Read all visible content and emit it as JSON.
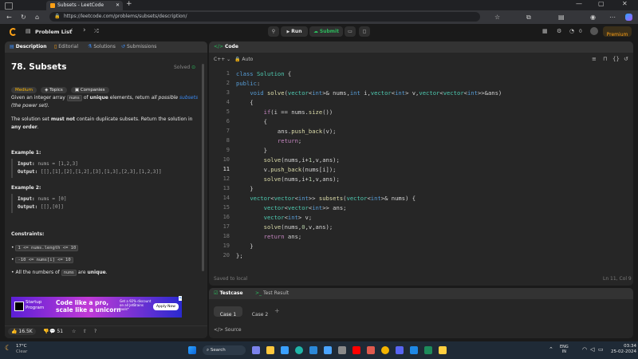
{
  "browser": {
    "tab_title": "Subsets - LeetCode",
    "new_tab": "+",
    "url": "https://leetcode.com/problems/subsets/description/"
  },
  "header": {
    "problem_list": "Problem List",
    "run": "Run",
    "submit": "Submit",
    "streak": "0",
    "premium": "Premium"
  },
  "left_tabs": [
    "Description",
    "Editorial",
    "Solutions",
    "Submissions"
  ],
  "problem": {
    "title": "78. Subsets",
    "status": "Solved",
    "difficulty": "Medium",
    "topics": "Topics",
    "companies": "Companies",
    "desc_1_a": "Given an integer array ",
    "desc_1_code": "nums",
    "desc_1_b": " of ",
    "desc_1_bold": "unique",
    "desc_1_c": " elements, return ",
    "desc_1_i": "all possible ",
    "desc_1_link": "subsets",
    "desc_1_d": " (the power set).",
    "desc_2_a": "The solution set ",
    "desc_2_bold": "must not",
    "desc_2_b": " contain duplicate subsets. Return the solution in ",
    "desc_2_bold2": "any order",
    "desc_2_c": ".",
    "ex1_title": "Example 1:",
    "ex1_input_label": "Input:",
    "ex1_input": "nums = [1,2,3]",
    "ex1_output_label": "Output:",
    "ex1_output": "[[],[1],[2],[1,2],[3],[1,3],[2,3],[1,2,3]]",
    "ex2_title": "Example 2:",
    "ex2_input_label": "Input:",
    "ex2_input": "nums = [0]",
    "ex2_output_label": "Output:",
    "ex2_output": "[[],[0]]",
    "constraints_title": "Constraints:",
    "c1": "1 <= nums.length <= 10",
    "c2": "-10 <= nums[i] <= 10",
    "c3_a": "All the numbers of ",
    "c3_code": "nums",
    "c3_b": " are ",
    "c3_bold": "unique",
    "c3_c": ".",
    "likes": "16.5K",
    "comments": "51"
  },
  "ad": {
    "brand_line1": "Startup",
    "brand_line2": "Program",
    "headline1": "Code like a pro,",
    "headline2": "scale like a unicorn",
    "offer": "Get a 92% discount on all JetBrains tools*",
    "cta": "Apply Now"
  },
  "code": {
    "tab": "Code",
    "lang": "C++",
    "mode": "Auto",
    "saved": "Saved to local",
    "cursor": "Ln 11, Col 9",
    "line_numbers": [
      "1",
      "2",
      "3",
      "4",
      "5",
      "6",
      "7",
      "8",
      "9",
      "10",
      "11",
      "12",
      "13",
      "14",
      "15",
      "16",
      "17",
      "18",
      "19",
      "20"
    ]
  },
  "test": {
    "tab1": "Testcase",
    "tab2": "Test Result",
    "case1": "Case 1",
    "case2": "Case 2",
    "add": "+",
    "source": "Source"
  },
  "taskbar": {
    "temp": "17°C",
    "weather": "Clear",
    "search": "Search",
    "lang1": "ENG",
    "lang2": "IN",
    "time": "03:34",
    "date": "25-02-2024"
  }
}
